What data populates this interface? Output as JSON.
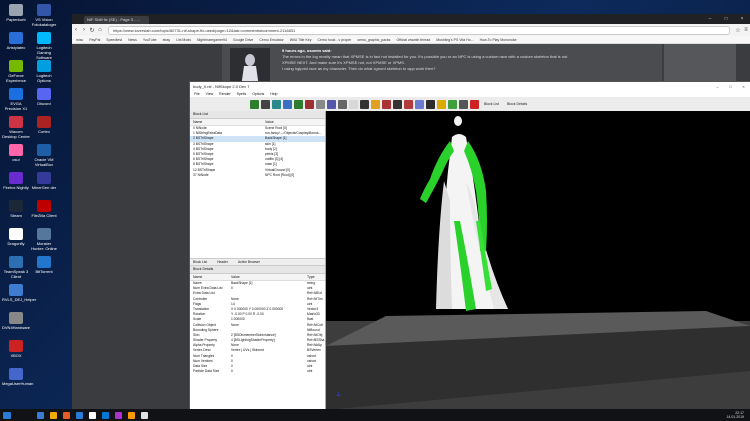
{
  "desktop": {
    "icons": [
      {
        "label": "Papierkorb",
        "color": "#9aa4b0"
      },
      {
        "label": "Artstylatec",
        "color": "#2a6ed8"
      },
      {
        "label": "GeForce Experience",
        "color": "#76b900"
      },
      {
        "label": "EVGA Precision X1",
        "color": "#1c6fe0"
      },
      {
        "label": "Wacom Desktop Center",
        "color": "#cc3344"
      },
      {
        "label": "osu!",
        "color": "#ff66aa"
      },
      {
        "label": "Firefox Nightly",
        "color": "#6a2ccf"
      },
      {
        "label": "Steam",
        "color": "#1b2838"
      },
      {
        "label": "Dragonfly",
        "color": "#ffffff"
      },
      {
        "label": "TeamSpeak 3 Client",
        "color": "#2d6fb3"
      },
      {
        "label": "RVLS_DEJ_Helper",
        "color": "#3d7cd0"
      },
      {
        "label": "DVN4Hardware",
        "color": "#888888"
      },
      {
        "label": "XBOX",
        "color": "#cc2222"
      },
      {
        "label": "MegaUserHuman",
        "color": "#4466cc"
      }
    ],
    "icons2": [
      {
        "label": "VS Vision Fotokataloger",
        "color": "#3355aa"
      },
      {
        "label": "Logitech Gaming Software",
        "color": "#00b8fc"
      },
      {
        "label": "Logitech Options",
        "color": "#00a0e0"
      },
      {
        "label": "Discord",
        "color": "#5865f2"
      },
      {
        "label": "Cortex",
        "color": "#aa2222"
      },
      {
        "label": "Oracle VM VirtualBox",
        "color": "#1d5fa6"
      },
      {
        "label": "MinerGen der",
        "color": "#333a99"
      },
      {
        "label": "FileZilla Client",
        "color": "#bf0000"
      },
      {
        "label": "Monster Hunter: Online",
        "color": "#557799"
      },
      {
        "label": "BitTorrent",
        "color": "#2277cc"
      }
    ]
  },
  "browser": {
    "tab_title": "NIF Shift fix (SE) - Page 3 - ...",
    "url": "https://www.loverslab.com/topic/80731-nif-shape-fix-used/page=12&tab=comments#comment-2116831",
    "bookmarks": [
      "misc",
      "PayPal",
      "Speedtest",
      "News",
      "YouTube",
      "ebay",
      "Uni Mods",
      "Nightmaregamer94",
      "Google Drive",
      "Cemu Emulator",
      "WiiU Title Key",
      "Cemu hook - v proper",
      "cemu_graphic_packs",
      "Official wwwtin thread",
      "Mushling's PS Vita Ho...",
      "How-To Play Mononoke"
    ],
    "post_meta": "9 hours ago, osomin said:",
    "post_lines": [
      "The errors in the log mostly mean that XPMSE is in fact not installed for you. It's possible you or an NPC is using a custom race with a custom skeleton that is not",
      "XPMSE NEXT. And make sure it's XPMSE not, not XPMSE or XPMS.",
      "",
      "I using hglpoid race as my character. Then do what xgnord skeleton to wpp work then?"
    ],
    "side_bits": [
      "...",
      "...",
      "ply",
      "..."
    ]
  },
  "nifskope": {
    "title": "body_0.nif - NifSkope 2.0 Dev 7",
    "menu": [
      "File",
      "View",
      "Render",
      "Spells",
      "Options",
      "Help"
    ],
    "toolbar_colors": [
      "#2f7d2f",
      "#444444",
      "#2a8a8a",
      "#3b6fc2",
      "#2f7d2f",
      "#9c2f2f",
      "#888888",
      "#5555aa",
      "#666666",
      "#d8d8d8",
      "#333333",
      "#e0a020",
      "#aa3333",
      "#333333",
      "#b23a3a",
      "#6b7bd0",
      "#2d2d2d",
      "#ddaa00",
      "#3f9f3f",
      "#555555",
      "#cc2222"
    ],
    "toolbar_texts": [
      "Block List",
      "Block Details"
    ],
    "block_list": {
      "title": "Block List",
      "headers": [
        "Name",
        "Value"
      ],
      "rows": [
        {
          "name": "0 NiNode",
          "value": "Scene Root [0]",
          "sel": false
        },
        {
          "name": "1 NiStringExtraData",
          "value": "run-fancy/..../Objects/Cosplay/Bonus...",
          "sel": false
        },
        {
          "name": "2 BSTriShape",
          "value": "BackShape [1]",
          "sel": true
        },
        {
          "name": "3 BSTriShape",
          "value": "skin [1]",
          "sel": false
        },
        {
          "name": "4 BSTriShape",
          "value": "body [2]",
          "sel": false
        },
        {
          "name": "5 BSTriShape",
          "value": "pelvis [3]",
          "sel": false
        },
        {
          "name": "6 BSTriShape",
          "value": "outfits [3] [4]",
          "sel": false
        },
        {
          "name": "8 BSTriShape",
          "value": "main [1]",
          "sel": false
        },
        {
          "name": "12 BSTriShape",
          "value": "VirtualGround [0]",
          "sel": false
        },
        {
          "name": "37 NiNode",
          "value": "NPC Root [Root] [0]",
          "sel": false
        }
      ],
      "tabs": [
        "Block List",
        "Header",
        "Active Browser"
      ]
    },
    "details": {
      "title": "Block Details",
      "headers": [
        "Name",
        "Value",
        "Type"
      ],
      "rows": [
        {
          "name": "Name",
          "value": "BackShape [1]",
          "type": "string"
        },
        {
          "name": "Num Extra Data List",
          "value": "0",
          "type": "uint"
        },
        {
          "name": "Extra Data List",
          "value": "",
          "type": "Ref<NiExt"
        },
        {
          "name": "Controller",
          "value": "None",
          "type": "Ref<NiTim"
        },
        {
          "name": "Flags",
          "value": "14",
          "type": "uint"
        },
        {
          "name": "Translation",
          "value": "X 0.000000 Y 0.000000 Z 0.000000",
          "type": "Vector3"
        },
        {
          "name": "Rotation",
          "value": "Y -0.00 P 0.00 R -0.00",
          "type": "Matrix33"
        },
        {
          "name": "Scale",
          "value": "1.000000",
          "type": "float"
        },
        {
          "name": "Collision Object",
          "value": "None",
          "type": "Ref<NiColl"
        },
        {
          "name": "Bounding Sphere",
          "value": "",
          "type": "NiBound"
        },
        {
          "name": "Skin",
          "value": "2 [BSDismemberSkinInstance]",
          "type": "Ref<NiObj"
        },
        {
          "name": "Shader Property",
          "value": "4 [BSLightingShaderProperty]",
          "type": "Ref<BSSha"
        },
        {
          "name": "Alpha Property",
          "value": "None",
          "type": "Ref<NiAlp"
        },
        {
          "name": "Vertex Desc",
          "value": "Vertex | UVs | Skinned",
          "type": "BSVertex"
        },
        {
          "name": "Num Triangles",
          "value": "0",
          "type": "ushort"
        },
        {
          "name": "Num Vertices",
          "value": "0",
          "type": "ushort"
        },
        {
          "name": "Data Size",
          "value": "0",
          "type": "uint"
        },
        {
          "name": "Particle Data Size",
          "value": "0",
          "type": "uint"
        }
      ]
    }
  },
  "taskbar": {
    "time": "22:17",
    "date": "14.01.2019",
    "apps": [
      "#3a7bd5",
      "#f2a900",
      "#e55b2a",
      "#2a7bd5",
      "#ffffff",
      "#0078d7",
      "#aa33cc",
      "#ff9900",
      "#e0e0e0"
    ]
  }
}
